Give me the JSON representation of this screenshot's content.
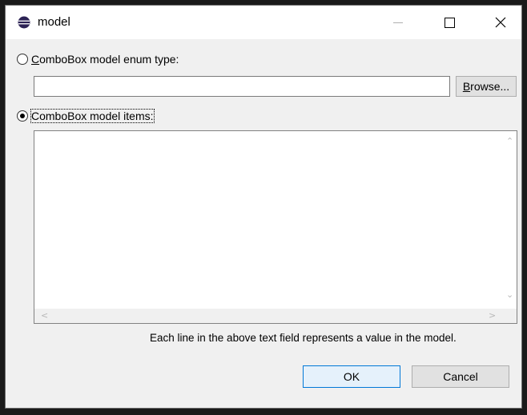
{
  "window": {
    "title": "model",
    "controls": {
      "minimize": "minimize",
      "maximize": "maximize",
      "close": "close"
    }
  },
  "options": {
    "enum_type": {
      "label_prefix": "",
      "label_mnemonic": "C",
      "label_rest": "omboBox model enum type:",
      "selected": false
    },
    "items": {
      "label": "ComboBox model items:",
      "selected": true
    }
  },
  "enum_field": {
    "value": "",
    "placeholder": ""
  },
  "browse": {
    "mnemonic": "B",
    "rest": "rowse..."
  },
  "items_text": {
    "value": ""
  },
  "info": "Each line in the above text field represents a value in the model.",
  "buttons": {
    "ok": "OK",
    "cancel": "Cancel"
  },
  "icons": {
    "app": "eclipse-icon",
    "scroll_up": "chevron-up-icon",
    "scroll_down": "chevron-down-icon",
    "scroll_left": "chevron-left-icon",
    "scroll_right": "chevron-right-icon"
  },
  "colors": {
    "accent": "#0078d7",
    "window_bg": "#f0f0f0",
    "title_bg": "#ffffff",
    "app_icon": "#2c2255"
  }
}
